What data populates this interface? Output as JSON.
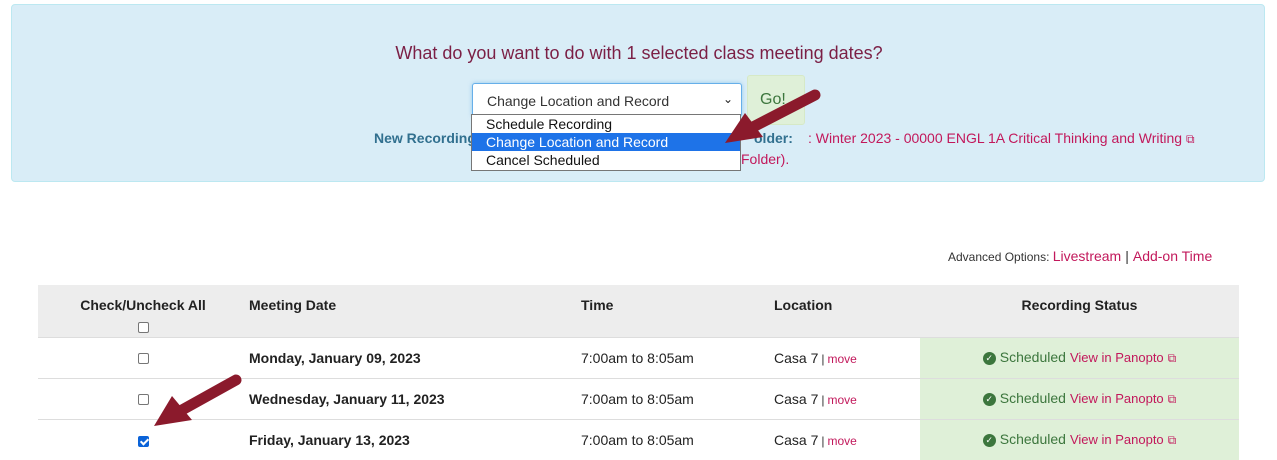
{
  "dialog": {
    "question": "What do you want to do with 1 selected class meeting dates?",
    "select_value": "Change Location and Record",
    "go_label": "Go!",
    "new_recording_label": "New Recording",
    "folder_label": "older:",
    "folder_link": ": Winter 2023 - 00000 ENGL 1A Critical Thinking and Writing",
    "folder_link_tail": "Folder)."
  },
  "dropdown": {
    "options": [
      "Schedule Recording",
      "Change Location and Record",
      "Cancel Scheduled"
    ],
    "selected_index": 1
  },
  "advanced": {
    "label": "Advanced Options:",
    "livestream": "Livestream",
    "separator": "|",
    "addon": "Add-on Time"
  },
  "table": {
    "headers": [
      "Check/Uncheck All",
      "Meeting Date",
      "Time",
      "Location",
      "Recording Status"
    ],
    "rows": [
      {
        "checked": false,
        "date": "Monday, January 09, 2023",
        "time": "7:00am to 8:05am",
        "location": "Casa 7",
        "move": "move",
        "status": "Scheduled",
        "view": "View in Panopto"
      },
      {
        "checked": false,
        "date": "Wednesday, January 11, 2023",
        "time": "7:00am to 8:05am",
        "location": "Casa 7",
        "move": "move",
        "status": "Scheduled",
        "view": "View in Panopto"
      },
      {
        "checked": true,
        "date": "Friday, January 13, 2023",
        "time": "7:00am to 8:05am",
        "location": "Casa 7",
        "move": "move",
        "status": "Scheduled",
        "view": "View in Panopto"
      }
    ]
  },
  "colors": {
    "accent_link": "#c2185b",
    "success_bg": "#dff0d8",
    "arrow": "#8b1a2c"
  }
}
